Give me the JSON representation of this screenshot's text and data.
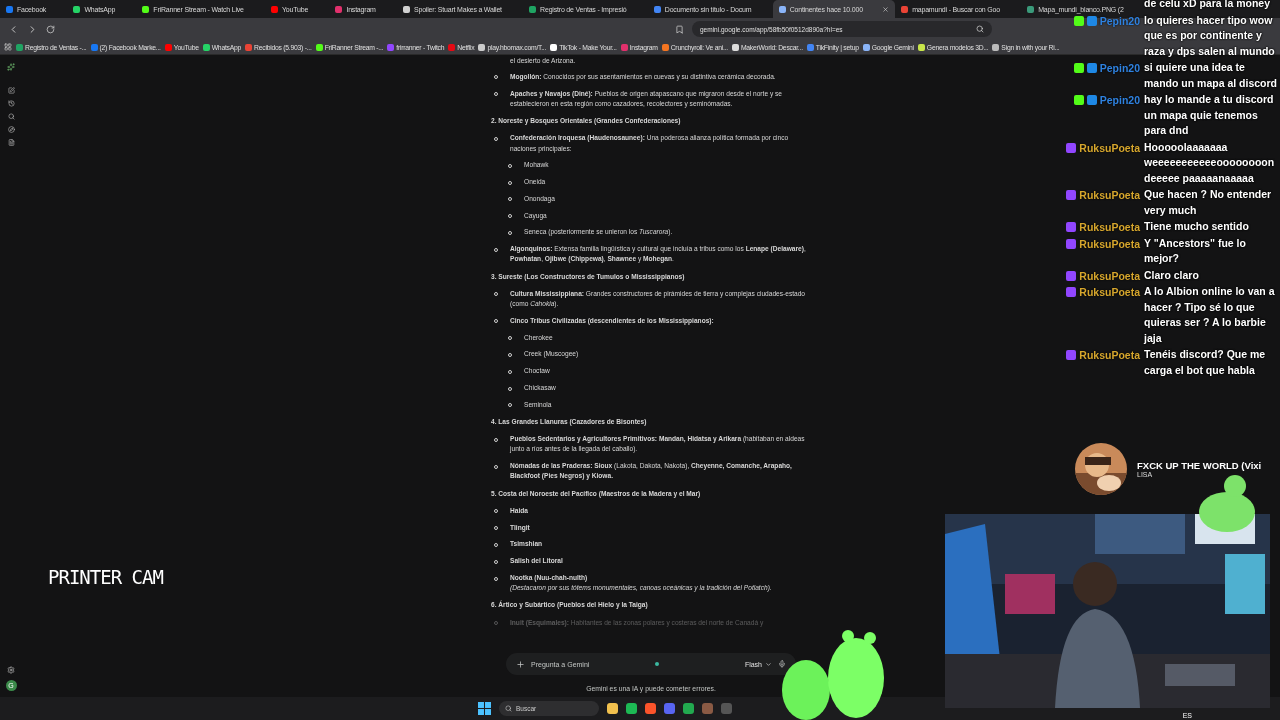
{
  "browser": {
    "tabs": [
      {
        "label": "Facebook",
        "selected": false,
        "color": "#1877f2"
      },
      {
        "label": "WhatsApp",
        "selected": false,
        "color": "#25d366"
      },
      {
        "label": "FriRanner Stream - Watch Live",
        "selected": false,
        "color": "#53fc18"
      },
      {
        "label": "YouTube",
        "selected": false,
        "color": "#ff0000"
      },
      {
        "label": "Instagram",
        "selected": false,
        "color": "#e1306c"
      },
      {
        "label": "Spoiler: Stuart Makes a Wallet",
        "selected": false,
        "color": "#d0d0d0"
      },
      {
        "label": "Registro de Ventas - Impresió",
        "selected": false,
        "color": "#1fa463"
      },
      {
        "label": "Documento sin título - Docum",
        "selected": false,
        "color": "#4285f4"
      },
      {
        "label": "Continentes hace 10.000",
        "selected": true,
        "color": "#8ab4f8"
      },
      {
        "label": "mapamundi - Buscar con Goo",
        "selected": false,
        "color": "#ea4335"
      },
      {
        "label": "Mapa_mundi_blanco.PNG (2",
        "selected": false,
        "color": "#3a9a7a"
      }
    ],
    "url": "gemini.google.com/app/58fb50f0512d890a?hl=es",
    "bookmarks": [
      {
        "label": "Registro de Ventas -...",
        "color": "#1fa463"
      },
      {
        "label": "(2) Facebook Marke...",
        "color": "#1877f2"
      },
      {
        "label": "YouTube",
        "color": "#ff0000"
      },
      {
        "label": "WhatsApp",
        "color": "#25d366"
      },
      {
        "label": "Recibidos (5.903) -...",
        "color": "#ea4335"
      },
      {
        "label": "FriRanner Stream -...",
        "color": "#53fc18"
      },
      {
        "label": "frirranner - Twitch",
        "color": "#9146ff"
      },
      {
        "label": "Netflix",
        "color": "#e50914"
      },
      {
        "label": "play.hbomax.com/T...",
        "color": "#cccccc"
      },
      {
        "label": "TikTok - Make Your...",
        "color": "#ffffff"
      },
      {
        "label": "Instagram",
        "color": "#e1306c"
      },
      {
        "label": "Crunchyroll: Ve ani...",
        "color": "#f47521"
      },
      {
        "label": "MakerWorld: Descar...",
        "color": "#dddddd"
      },
      {
        "label": "TikFinity | setup",
        "color": "#4285f4"
      },
      {
        "label": "Google Gemini",
        "color": "#8ab4f8"
      },
      {
        "label": "Genera modelos 3D...",
        "color": "#c8e64a"
      },
      {
        "label": "Sign in with your Ri...",
        "color": "#bbbbbb"
      }
    ]
  },
  "sidebar": {
    "avatar": "G"
  },
  "document": {
    "sections": [
      {
        "items": [
          {
            "kind": "continuation",
            "text": "el desierto de Arizona."
          },
          {
            "kind": "bullet",
            "text": "**Mogollón:** Conocidos por sus asentamientos en cuevas y su distintiva cerámica decorada."
          },
          {
            "kind": "bullet",
            "text": "**Apaches y Navajos (Diné):** Pueblos de origen atapascano que migraron desde el norte y se establecieron en esta región como cazadores, recolectores y seminómadas."
          }
        ]
      },
      {
        "heading": "2. Noreste y Bosques Orientales (Grandes Confederaciones)",
        "items": [
          {
            "kind": "bullet",
            "text": "**Confederación Iroquesa (Haudenosaunee):** Una poderosa alianza política formada por cinco naciones principales:",
            "children": [
              {
                "text": "Mohawk"
              },
              {
                "text": "Oneida"
              },
              {
                "text": "Onondaga"
              },
              {
                "text": "Cayuga"
              },
              {
                "text": "Seneca (posteriormente se unieron los *Tuscarora*)."
              }
            ]
          },
          {
            "kind": "bullet",
            "text": "**Algonquinos:** Extensa familia lingüística y cultural que incluía a tribus como los **Lenape (Delaware)**, **Powhatan**, **Ojibwe (Chippewa)**, **Shawnee** y **Mohegan**."
          }
        ]
      },
      {
        "heading": "3. Sureste (Los Constructores de Tumulos o Mississippianos)",
        "items": [
          {
            "kind": "bullet",
            "text": "**Cultura Mississippiana:** Grandes constructores de pirámides de tierra y complejas ciudades-estado (como *Cahokia*)."
          },
          {
            "kind": "bullet",
            "text": "**Cinco Tribus Civilizadas (descendientes de los Mississippianos):**",
            "children": [
              {
                "text": "Cherokee"
              },
              {
                "text": "Creek (Muscogee)"
              },
              {
                "text": "Choctaw"
              },
              {
                "text": "Chickasaw"
              },
              {
                "text": "Seminola"
              }
            ]
          }
        ]
      },
      {
        "heading": "4. Las Grandes Llanuras (Cazadores de Bisontes)",
        "items": [
          {
            "kind": "bullet",
            "text": "**Pueblos Sedentarios y Agricultores Primitivos: Mandan, Hidatsa y Arikara** (habitaban en aldeas junto a ríos antes de la llegada del caballo)."
          },
          {
            "kind": "bullet",
            "text": "**Nómadas de las Praderas: Sioux** (Lakota, Dakota, Nakota), **Cheyenne, Comanche, Arapaho, Blackfoot (Pies Negros) y Kiowa.**"
          }
        ]
      },
      {
        "heading": "5. Costa del Noroeste del Pacífico (Maestros de la Madera y el Mar)",
        "items": [
          {
            "kind": "bullet",
            "text": "**Haida**"
          },
          {
            "kind": "bullet",
            "text": "**Tlingit**"
          },
          {
            "kind": "bullet",
            "text": "**Tsimshian**"
          },
          {
            "kind": "bullet",
            "text": "**Salish del Litoral**"
          },
          {
            "kind": "bullet",
            "text": "**Nootka (Nuu-chah-nulth)**",
            "note": "(Destacaron por sus tótems monumentales, canoas oceánicas y la tradición del Potlatch)."
          }
        ]
      },
      {
        "heading": "6. Ártico y Subártico (Pueblos del Hielo y la Taiga)",
        "items": [
          {
            "kind": "faded",
            "text": "**Inuit (Esquimales):** Habitantes de las zonas polares y costeras del norte de Canadá y"
          }
        ]
      }
    ]
  },
  "prompt": {
    "placeholder": "Pregunta a Gemini",
    "model": "Flash",
    "disclaimer": "Gemini es una IA y puede cometer errores."
  },
  "overlay": {
    "camera_label": "PRINTER CAM",
    "now_playing": {
      "title": "FXCK UP THE WORLD (Vixi",
      "artist": "LISA"
    },
    "chat": [
      {
        "kind": "continuation",
        "text": "de celu xD para la money"
      },
      {
        "kind": "kick",
        "author": "Pepin20",
        "text": "lo quieres hacer tipo wow que es por continente y raza y dps salen al mundo"
      },
      {
        "kind": "kick",
        "author": "Pepin20",
        "text": "si quiere una idea te mando un mapa al discord"
      },
      {
        "kind": "kick",
        "author": "Pepin20",
        "text": "hay lo mande a tu discord un mapa quie tenemos para dnd"
      },
      {
        "kind": "twitch",
        "author": "RuksuPoeta",
        "text": "Hooooolaaaaaaa weeeeeeeeeeeoooooooon deeeee paaaaanaaaaa"
      },
      {
        "kind": "twitch",
        "author": "RuksuPoeta",
        "text": "Que hacen ? No entender very much"
      },
      {
        "kind": "twitch",
        "author": "RuksuPoeta",
        "text": "Tiene mucho sentido"
      },
      {
        "kind": "twitch",
        "author": "RuksuPoeta",
        "text": "Y \"Ancestors\" fue lo mejor?"
      },
      {
        "kind": "twitch",
        "author": "RuksuPoeta",
        "text": "Claro claro"
      },
      {
        "kind": "twitch",
        "author": "RuksuPoeta",
        "text": "A lo Albion online lo van a hacer ? Tipo sé lo que quieras ser ? A lo barbie jaja"
      },
      {
        "kind": "twitch",
        "author": "RuksuPoeta",
        "text": "Tenéis discord? Que me carga el bot que habla"
      }
    ]
  },
  "taskbar": {
    "search_placeholder": "Buscar",
    "language": "ES"
  }
}
